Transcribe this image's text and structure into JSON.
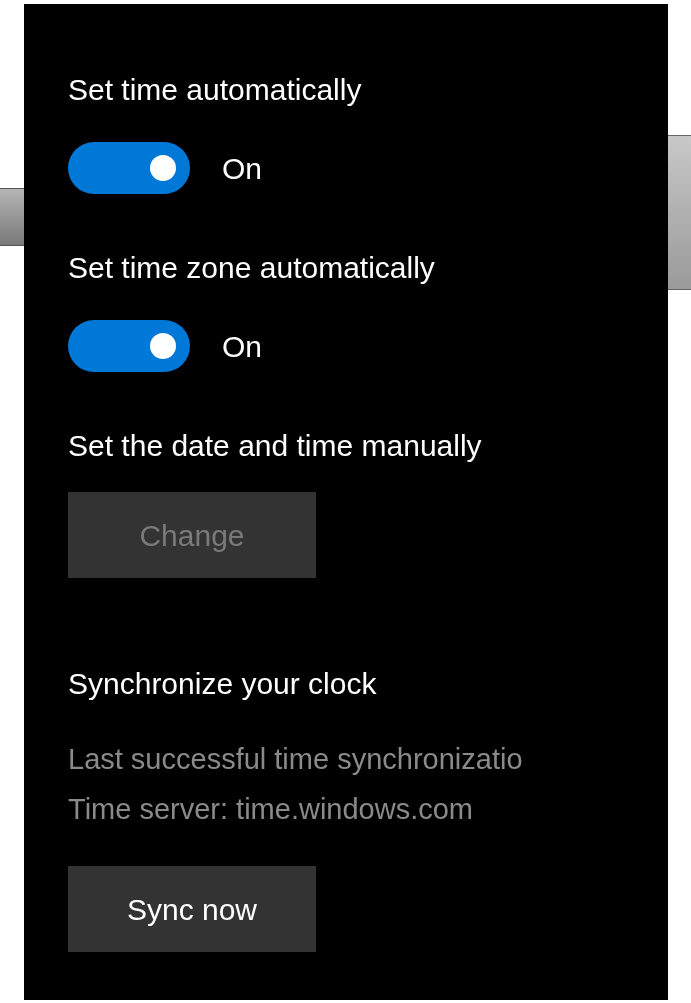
{
  "sections": [
    {
      "kind": "toggle",
      "title": "Set time automatically",
      "on": true,
      "state_label": "On"
    },
    {
      "kind": "toggle",
      "title": "Set time zone automatically",
      "on": true,
      "state_label": "On"
    },
    {
      "kind": "button",
      "title": "Set the date and time manually",
      "button": "Change",
      "disabled": true
    },
    {
      "kind": "sync",
      "title": "Synchronize your clock",
      "lines": [
        "Last successful time synchronizatio",
        "Time server: time.windows.com"
      ],
      "button": "Sync now",
      "disabled": false
    }
  ]
}
